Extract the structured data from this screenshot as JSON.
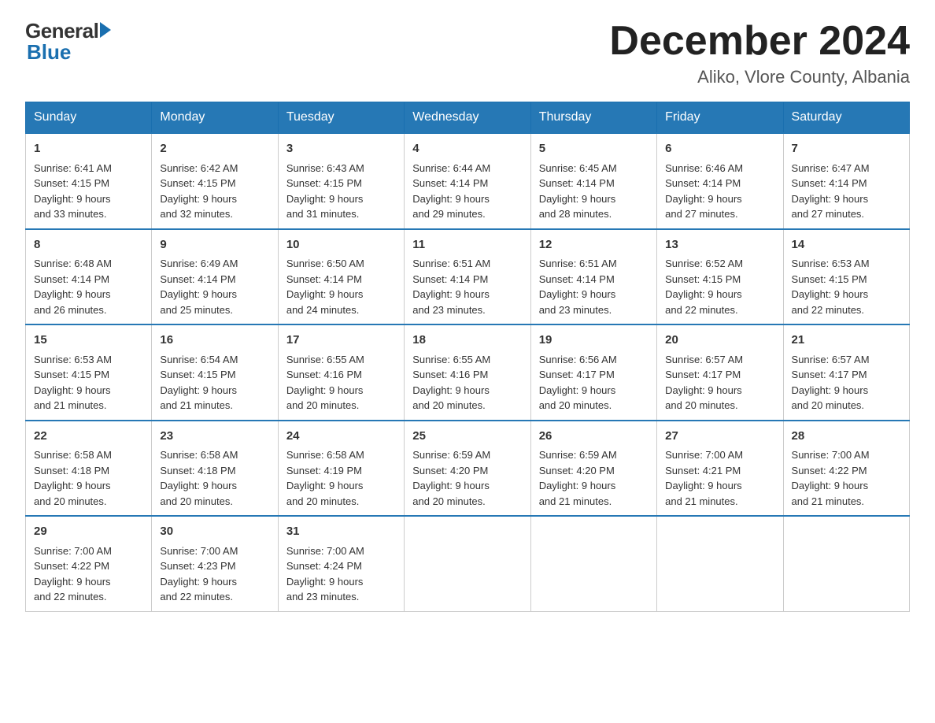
{
  "logo": {
    "general": "General",
    "blue": "Blue"
  },
  "title": {
    "month_year": "December 2024",
    "location": "Aliko, Vlore County, Albania"
  },
  "days_of_week": [
    "Sunday",
    "Monday",
    "Tuesday",
    "Wednesday",
    "Thursday",
    "Friday",
    "Saturday"
  ],
  "weeks": [
    [
      {
        "day": "1",
        "sunrise": "6:41 AM",
        "sunset": "4:15 PM",
        "daylight": "9 hours and 33 minutes."
      },
      {
        "day": "2",
        "sunrise": "6:42 AM",
        "sunset": "4:15 PM",
        "daylight": "9 hours and 32 minutes."
      },
      {
        "day": "3",
        "sunrise": "6:43 AM",
        "sunset": "4:15 PM",
        "daylight": "9 hours and 31 minutes."
      },
      {
        "day": "4",
        "sunrise": "6:44 AM",
        "sunset": "4:14 PM",
        "daylight": "9 hours and 29 minutes."
      },
      {
        "day": "5",
        "sunrise": "6:45 AM",
        "sunset": "4:14 PM",
        "daylight": "9 hours and 28 minutes."
      },
      {
        "day": "6",
        "sunrise": "6:46 AM",
        "sunset": "4:14 PM",
        "daylight": "9 hours and 27 minutes."
      },
      {
        "day": "7",
        "sunrise": "6:47 AM",
        "sunset": "4:14 PM",
        "daylight": "9 hours and 27 minutes."
      }
    ],
    [
      {
        "day": "8",
        "sunrise": "6:48 AM",
        "sunset": "4:14 PM",
        "daylight": "9 hours and 26 minutes."
      },
      {
        "day": "9",
        "sunrise": "6:49 AM",
        "sunset": "4:14 PM",
        "daylight": "9 hours and 25 minutes."
      },
      {
        "day": "10",
        "sunrise": "6:50 AM",
        "sunset": "4:14 PM",
        "daylight": "9 hours and 24 minutes."
      },
      {
        "day": "11",
        "sunrise": "6:51 AM",
        "sunset": "4:14 PM",
        "daylight": "9 hours and 23 minutes."
      },
      {
        "day": "12",
        "sunrise": "6:51 AM",
        "sunset": "4:14 PM",
        "daylight": "9 hours and 23 minutes."
      },
      {
        "day": "13",
        "sunrise": "6:52 AM",
        "sunset": "4:15 PM",
        "daylight": "9 hours and 22 minutes."
      },
      {
        "day": "14",
        "sunrise": "6:53 AM",
        "sunset": "4:15 PM",
        "daylight": "9 hours and 22 minutes."
      }
    ],
    [
      {
        "day": "15",
        "sunrise": "6:53 AM",
        "sunset": "4:15 PM",
        "daylight": "9 hours and 21 minutes."
      },
      {
        "day": "16",
        "sunrise": "6:54 AM",
        "sunset": "4:15 PM",
        "daylight": "9 hours and 21 minutes."
      },
      {
        "day": "17",
        "sunrise": "6:55 AM",
        "sunset": "4:16 PM",
        "daylight": "9 hours and 20 minutes."
      },
      {
        "day": "18",
        "sunrise": "6:55 AM",
        "sunset": "4:16 PM",
        "daylight": "9 hours and 20 minutes."
      },
      {
        "day": "19",
        "sunrise": "6:56 AM",
        "sunset": "4:17 PM",
        "daylight": "9 hours and 20 minutes."
      },
      {
        "day": "20",
        "sunrise": "6:57 AM",
        "sunset": "4:17 PM",
        "daylight": "9 hours and 20 minutes."
      },
      {
        "day": "21",
        "sunrise": "6:57 AM",
        "sunset": "4:17 PM",
        "daylight": "9 hours and 20 minutes."
      }
    ],
    [
      {
        "day": "22",
        "sunrise": "6:58 AM",
        "sunset": "4:18 PM",
        "daylight": "9 hours and 20 minutes."
      },
      {
        "day": "23",
        "sunrise": "6:58 AM",
        "sunset": "4:18 PM",
        "daylight": "9 hours and 20 minutes."
      },
      {
        "day": "24",
        "sunrise": "6:58 AM",
        "sunset": "4:19 PM",
        "daylight": "9 hours and 20 minutes."
      },
      {
        "day": "25",
        "sunrise": "6:59 AM",
        "sunset": "4:20 PM",
        "daylight": "9 hours and 20 minutes."
      },
      {
        "day": "26",
        "sunrise": "6:59 AM",
        "sunset": "4:20 PM",
        "daylight": "9 hours and 21 minutes."
      },
      {
        "day": "27",
        "sunrise": "7:00 AM",
        "sunset": "4:21 PM",
        "daylight": "9 hours and 21 minutes."
      },
      {
        "day": "28",
        "sunrise": "7:00 AM",
        "sunset": "4:22 PM",
        "daylight": "9 hours and 21 minutes."
      }
    ],
    [
      {
        "day": "29",
        "sunrise": "7:00 AM",
        "sunset": "4:22 PM",
        "daylight": "9 hours and 22 minutes."
      },
      {
        "day": "30",
        "sunrise": "7:00 AM",
        "sunset": "4:23 PM",
        "daylight": "9 hours and 22 minutes."
      },
      {
        "day": "31",
        "sunrise": "7:00 AM",
        "sunset": "4:24 PM",
        "daylight": "9 hours and 23 minutes."
      },
      null,
      null,
      null,
      null
    ]
  ],
  "labels": {
    "sunrise": "Sunrise:",
    "sunset": "Sunset:",
    "daylight": "Daylight:"
  }
}
